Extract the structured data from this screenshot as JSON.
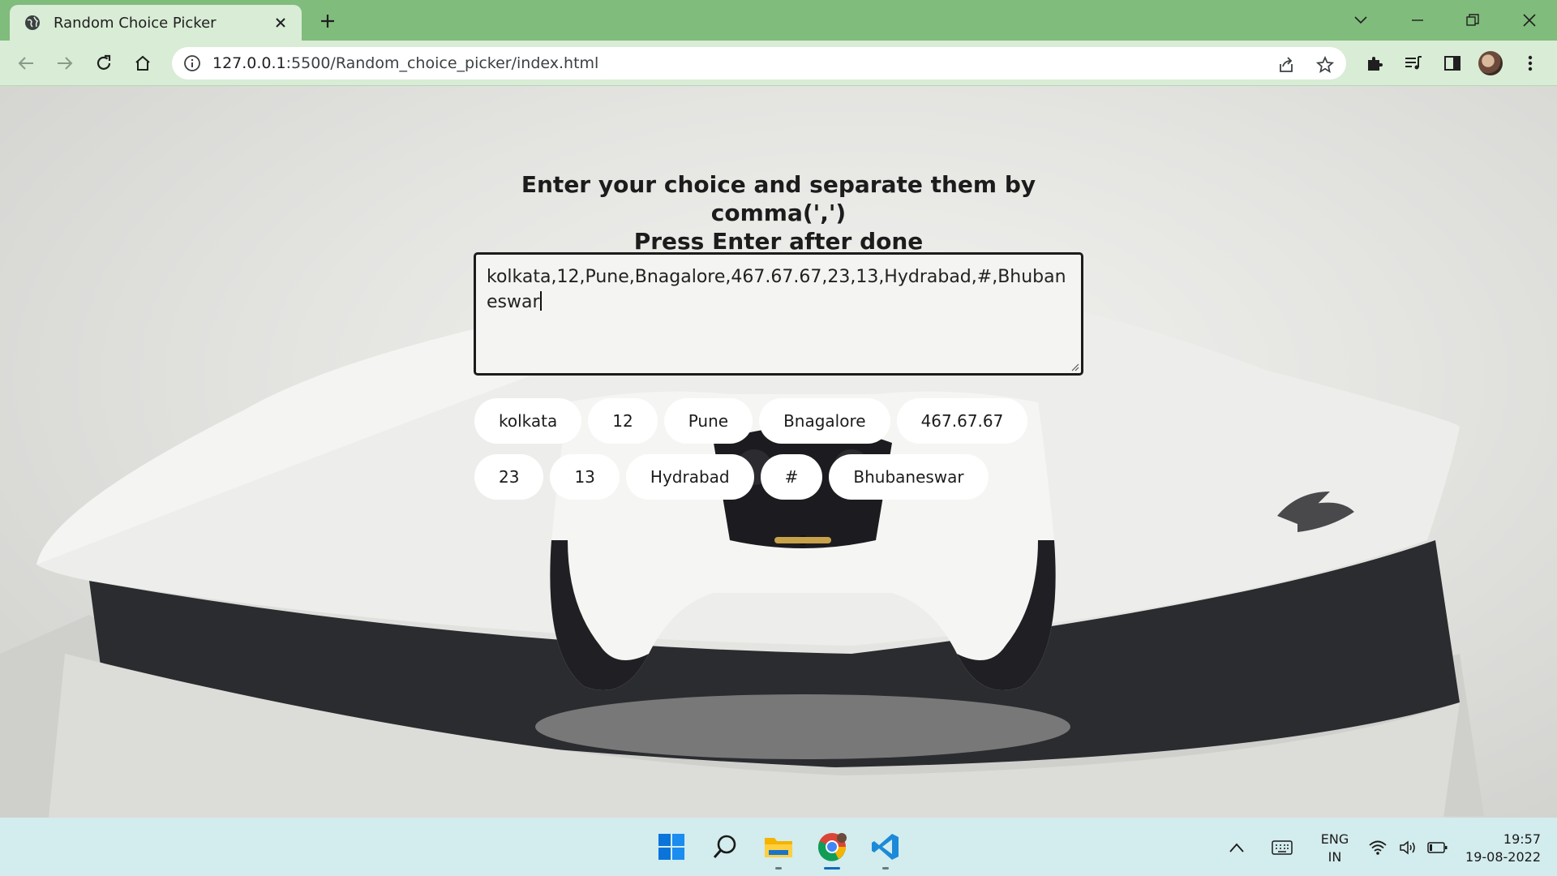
{
  "browser": {
    "tab_title": "Random Choice Picker",
    "url_host": "127.0.0.1",
    "url_rest": ":5500/Random_choice_picker/index.html"
  },
  "page": {
    "heading_line1": "Enter your choice and separate them by comma(',')",
    "heading_line2": "Press Enter after done",
    "textarea_value": "kolkata,12,Pune,Bnagalore,467.67.67,23,13,Hydrabad,#,Bhubaneswar",
    "tags": [
      "kolkata",
      "12",
      "Pune",
      "Bnagalore",
      "467.67.67",
      "23",
      "13",
      "Hydrabad",
      "#",
      "Bhubaneswar"
    ]
  },
  "taskbar": {
    "lang_line1": "ENG",
    "lang_line2": "IN",
    "time": "19:57",
    "date": "19-08-2022"
  },
  "colors": {
    "chrome_green": "#80bc7c",
    "toolbar_green": "#d9ecd6",
    "taskbar": "#d3ecee",
    "tag_bg": "#ffffff"
  }
}
